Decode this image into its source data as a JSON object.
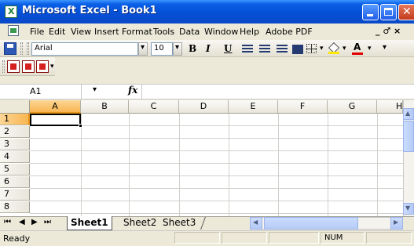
{
  "window": {
    "title": "Microsoft Excel - Book1"
  },
  "menu": {
    "items": [
      {
        "label": "File"
      },
      {
        "label": "Edit"
      },
      {
        "label": "View"
      },
      {
        "label": "Insert"
      },
      {
        "label": "Format"
      },
      {
        "label": "Tools"
      },
      {
        "label": "Data"
      },
      {
        "label": "Window"
      },
      {
        "label": "Help"
      },
      {
        "label": "Adobe PDF"
      }
    ],
    "right_controls": "_ ♂ ×"
  },
  "toolbar": {
    "font_name": "Arial",
    "font_size": "10",
    "bold": "B",
    "italic": "I",
    "underline": "U",
    "font_color_glyph": "A"
  },
  "formula_bar": {
    "name_box": "A1",
    "fx": "fx",
    "formula": ""
  },
  "grid": {
    "columns": [
      "A",
      "B",
      "C",
      "D",
      "E",
      "F",
      "G",
      "H"
    ],
    "rows": [
      "1",
      "2",
      "3",
      "4",
      "5",
      "6",
      "7",
      "8"
    ],
    "active_cell": "A1"
  },
  "sheets": {
    "tabs": [
      {
        "label": "Sheet1"
      },
      {
        "label": "Sheet2"
      },
      {
        "label": "Sheet3"
      }
    ],
    "active": "Sheet1",
    "nav": [
      "⏮",
      "◀",
      "▶",
      "⏭"
    ]
  },
  "status": {
    "text": "Ready",
    "num": "NUM"
  },
  "colors": {
    "title_bar": "#0450d6",
    "selected_header": "#f8b651",
    "window_bg": "#ece9d8"
  }
}
